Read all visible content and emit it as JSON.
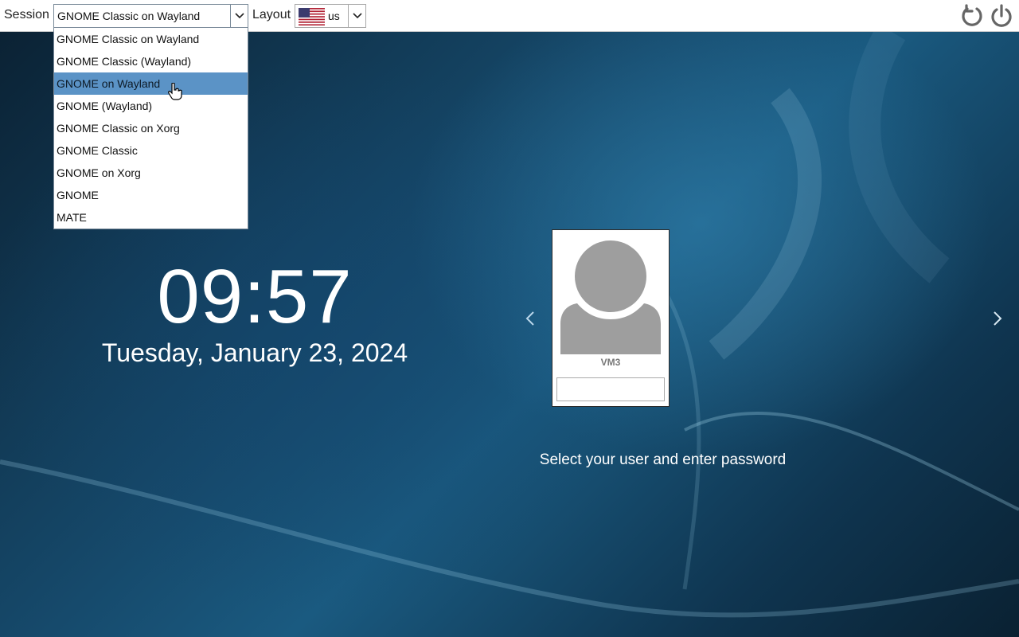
{
  "topbar": {
    "session_label": "Session",
    "session_value": "GNOME Classic on Wayland",
    "layout_label": "Layout",
    "layout_value": "us",
    "layout_flag_icon": "us-flag-icon",
    "restart_icon": "restart-icon",
    "power_icon": "power-icon"
  },
  "session_menu": {
    "items": [
      {
        "label": "GNOME Classic on Wayland"
      },
      {
        "label": "GNOME Classic (Wayland)"
      },
      {
        "label": "GNOME on Wayland"
      },
      {
        "label": "GNOME (Wayland)"
      },
      {
        "label": "GNOME Classic on Xorg"
      },
      {
        "label": "GNOME Classic"
      },
      {
        "label": "GNOME on Xorg"
      },
      {
        "label": "GNOME"
      },
      {
        "label": "MATE"
      }
    ],
    "highlighted_index": 2,
    "highlight_color": "#5b93c6"
  },
  "clock": {
    "time": "09:57",
    "date": "Tuesday, January 23, 2024"
  },
  "user": {
    "name": "VM3",
    "password_value": ""
  },
  "prompt": "Select your user and enter password"
}
